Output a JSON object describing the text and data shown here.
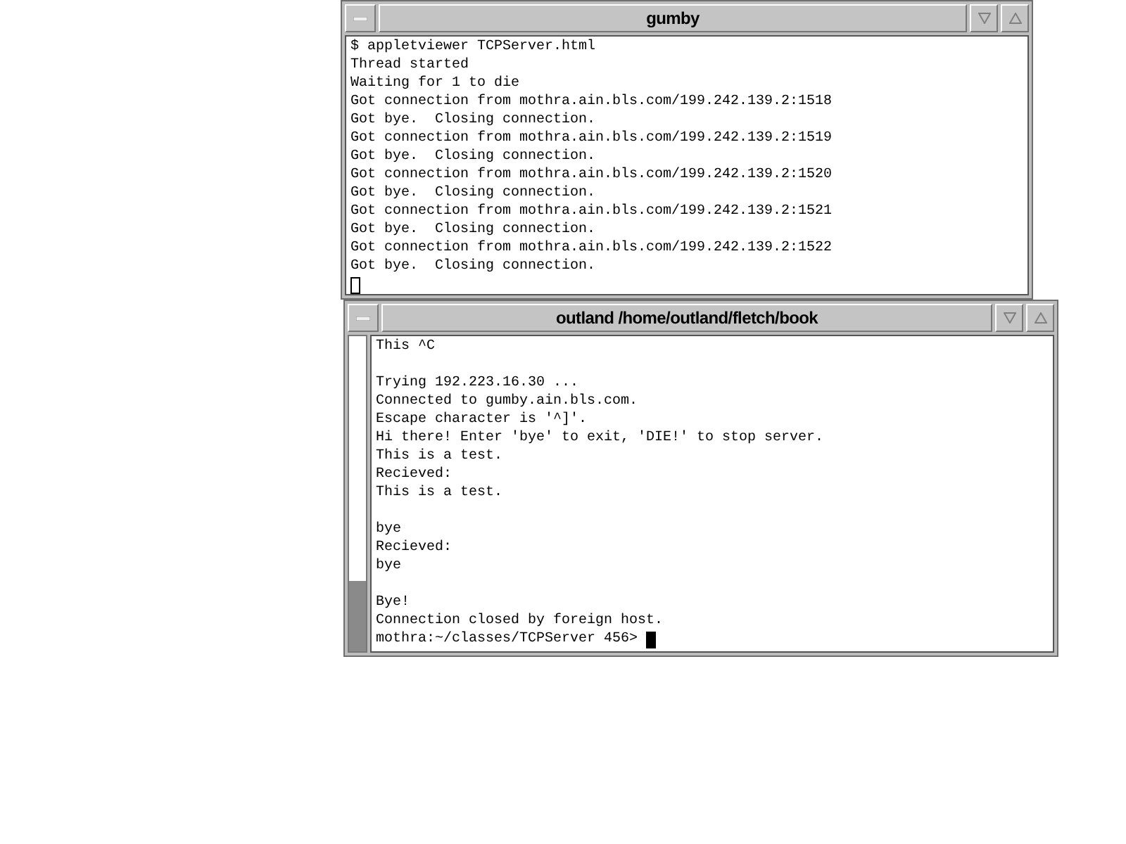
{
  "windows": [
    {
      "title": "gumby",
      "focused": false,
      "scrollbar": false,
      "blocks": [
        [
          "$ appletviewer TCPServer.html",
          "Thread started",
          "Waiting for 1 to die",
          "Got connection from mothra.ain.bls.com/199.242.139.2:1518",
          "Got bye.  Closing connection.",
          "Got connection from mothra.ain.bls.com/199.242.139.2:1519",
          "Got bye.  Closing connection.",
          "Got connection from mothra.ain.bls.com/199.242.139.2:1520",
          "Got bye.  Closing connection.",
          "Got connection from mothra.ain.bls.com/199.242.139.2:1521",
          "Got bye.  Closing connection.",
          "Got connection from mothra.ain.bls.com/199.242.139.2:1522",
          "Got bye.  Closing connection."
        ]
      ]
    },
    {
      "title": "outland /home/outland/fletch/book",
      "focused": true,
      "scrollbar": true,
      "blocks": [
        [
          "This ^C"
        ],
        [
          "Trying 192.223.16.30 ...",
          "Connected to gumby.ain.bls.com.",
          "Escape character is '^]'.",
          "Hi there! Enter 'bye' to exit, 'DIE!' to stop server.",
          "This is a test.",
          "Recieved:",
          "This is a test."
        ],
        [
          "bye",
          "Recieved:",
          "bye"
        ],
        [
          "Bye!",
          "Connection closed by foreign host."
        ]
      ],
      "prompt": "mothra:~/classes/TCPServer 456> "
    }
  ]
}
